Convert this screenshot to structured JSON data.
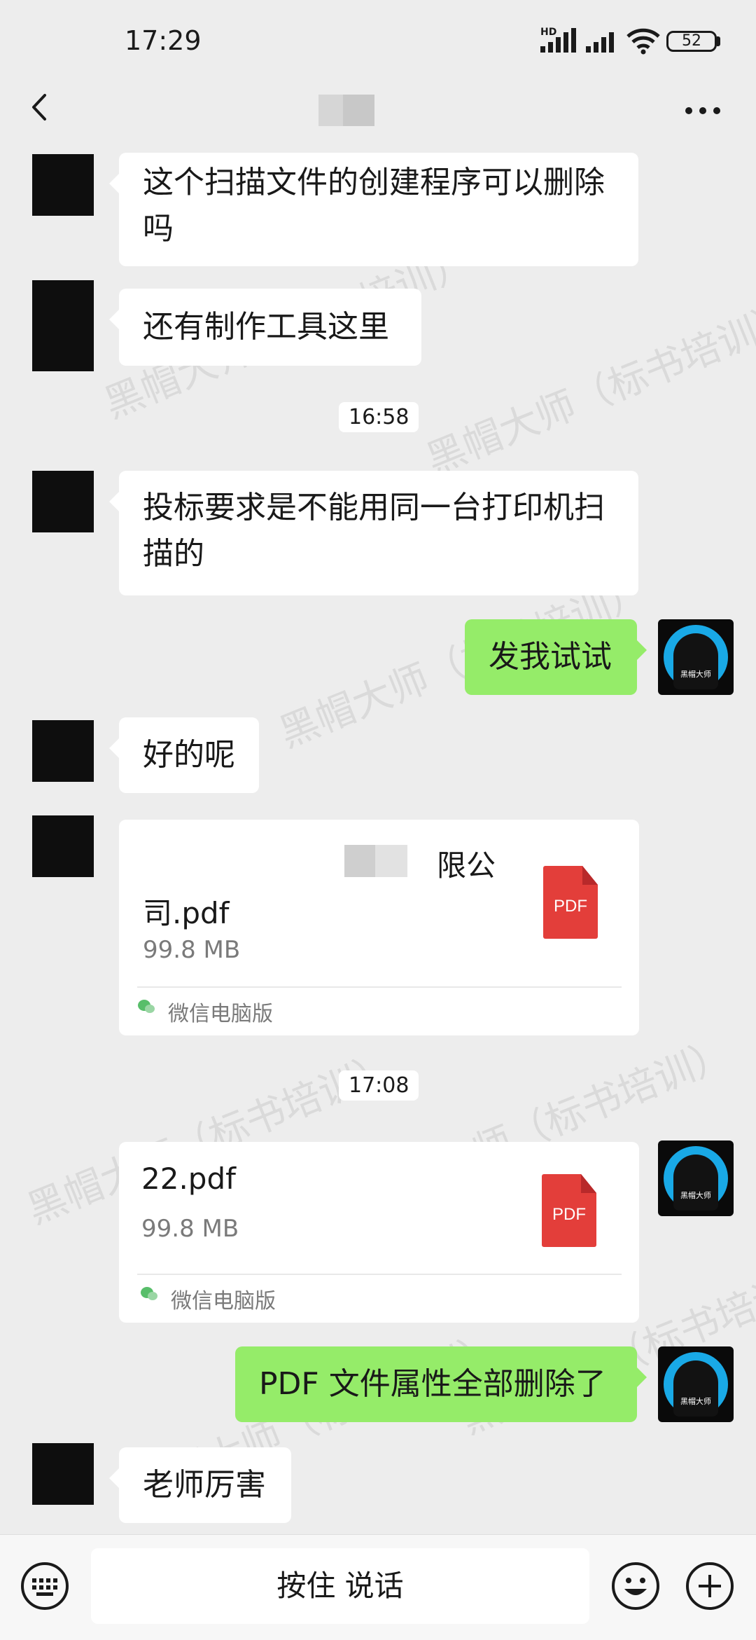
{
  "status_bar": {
    "time": "17:29",
    "hd": "HD",
    "battery": "52"
  },
  "nav": {
    "back": "back-icon",
    "more": "more-icon"
  },
  "messages": [
    {
      "text": "这个扫描文件的创建程序可以删除吗"
    },
    {
      "text": "还有制作工具这里"
    },
    {
      "timestamp": "16:58"
    },
    {
      "text": "投标要求是不能用同一台打印机扫描的"
    },
    {
      "text": "发我试试"
    },
    {
      "text": "好的呢"
    },
    {
      "file": {
        "name_top": "限公",
        "name_bottom": "司.pdf",
        "size": "99.8 MB",
        "source": "微信电脑版",
        "icon_text": "PDF"
      }
    },
    {
      "timestamp": "17:08"
    },
    {
      "file": {
        "name": "22.pdf",
        "size": "99.8 MB",
        "source": "微信电脑版",
        "icon_text": "PDF"
      }
    },
    {
      "text": "PDF 文件属性全部删除了"
    },
    {
      "text": "老师厉害"
    }
  ],
  "self_avatar_label": "黑帽大师",
  "watermark": "黑帽大师（标书培训）",
  "input": {
    "hold_to_talk": "按住 说话"
  },
  "colors": {
    "background": "#ededed",
    "self_bubble": "#95ec69",
    "other_bubble": "#ffffff",
    "pdf_red": "#e33e3a",
    "avatar_ring": "#19a9e6"
  }
}
